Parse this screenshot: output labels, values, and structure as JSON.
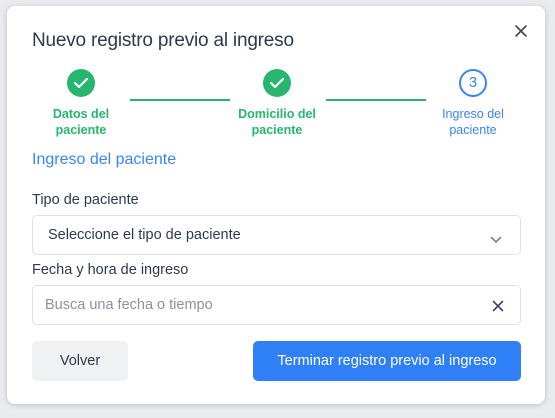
{
  "dialog": {
    "title": "Nuevo registro previo al ingreso",
    "close_icon": "close-icon"
  },
  "stepper": {
    "steps": [
      {
        "line1": "Datos del",
        "line2": "paciente",
        "status": "completed"
      },
      {
        "line1": "Domicilio del",
        "line2": "paciente",
        "status": "completed"
      },
      {
        "number": "3",
        "line1": "Ingreso del",
        "line2": "paciente",
        "status": "active"
      }
    ]
  },
  "section": {
    "title": "Ingreso del paciente"
  },
  "form": {
    "patient_type_label": "Tipo de paciente",
    "patient_type_value": "Seleccione el tipo de paciente",
    "datetime_label": "Fecha y hora de ingreso",
    "datetime_placeholder": "Busca una fecha o tiempo",
    "datetime_value": ""
  },
  "actions": {
    "back_label": "Volver",
    "finish_label": "Terminar registro previo al ingreso"
  },
  "colors": {
    "success": "#26b66e",
    "primary": "#2f80f7",
    "text": "#2e3a4b"
  }
}
